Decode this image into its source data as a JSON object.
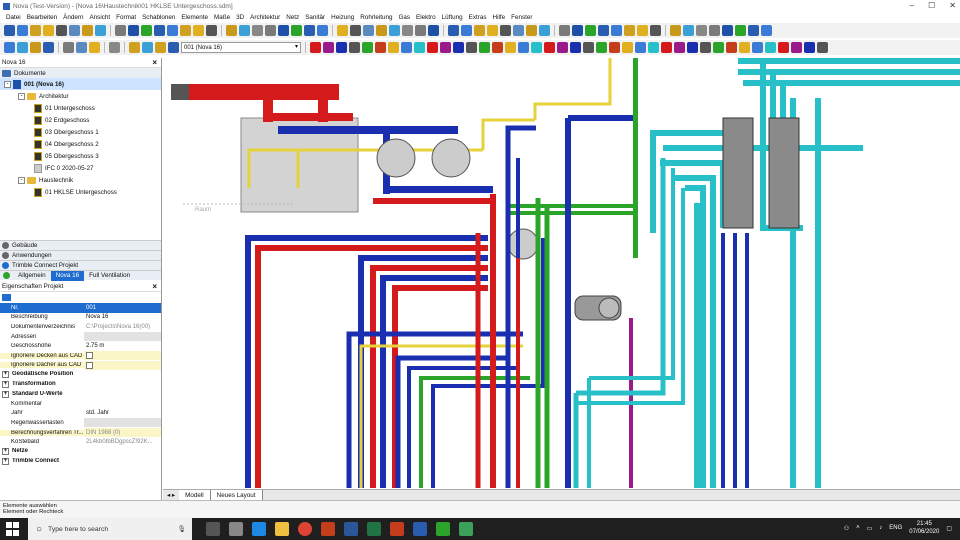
{
  "window": {
    "title": "Nova (Test-Version) - [Nova 16\\Haustechnik\\01 HKLSE Untergeschoss.sdm]"
  },
  "menu": [
    "Datei",
    "Bearbeiten",
    "Ändern",
    "Ansicht",
    "Format",
    "Schablonen",
    "Elemente",
    "Maße",
    "3D",
    "Architektur",
    "Netz",
    "Sanitär",
    "Heizung",
    "Rohrleitung",
    "Gas",
    "Elektro",
    "Lüftung",
    "Extras",
    "Hilfe",
    "Fenster"
  ],
  "toolbar": {
    "project_combo": "001 (Nova 16)"
  },
  "documents_panel": {
    "header": "Nova 16",
    "section": "Dokumente",
    "root": "001 (Nova 16)",
    "architektur": "Architektur",
    "floors": [
      "01 Untergeschoss",
      "02 Erdgeschoss",
      "03 Obergeschoss 1",
      "04 Obergeschoss 2",
      "05 Obergeschoss 3",
      "IFC 0 2020-05-27"
    ],
    "haustechnik": "Haustechnik",
    "ht_items": [
      "01 HKLSE Untergeschoss"
    ],
    "sections": [
      "Gebäude",
      "Anwendungen",
      "Trimble Connect Projekt"
    ],
    "tabs": [
      "Allgemein",
      "Nova 16",
      "Full Ventilation"
    ]
  },
  "properties_panel": {
    "header": "Eigenschaften Projekt",
    "rows": [
      {
        "name": "Nr.",
        "value": "001",
        "selected": true
      },
      {
        "name": "Beschreibung",
        "value": "Nova 16"
      },
      {
        "name": "Dokumentenverzeichnis",
        "value": "C:\\Projects\\Nova 16(00)"
      },
      {
        "name": "Adressen",
        "value": ""
      },
      {
        "name": "Geschosshöhe",
        "value": "2.75 m"
      },
      {
        "name": "Ignoriere Decken aus CAD",
        "value": "",
        "check": true,
        "hl": true
      },
      {
        "name": "Ignoriere Dächer aus CAD",
        "value": "",
        "check": true,
        "hl": true
      },
      {
        "name": "Geodätische Position",
        "value": "",
        "group": true
      },
      {
        "name": "Transformation",
        "value": "",
        "group": true
      },
      {
        "name": "Standard U-Werte",
        "value": "",
        "group": true
      },
      {
        "name": "Kommentar",
        "value": ""
      },
      {
        "name": "Jahr",
        "value": "std. Jahr"
      },
      {
        "name": "Regenwasserlasten",
        "value": ""
      },
      {
        "name": "Berechnungsverfahren Tr...",
        "value": "DIN 1988 (0)",
        "hl": true
      },
      {
        "name": "KoStebaId",
        "value": "2L4kb0IbBDgpscZ!92K..."
      },
      {
        "name": "Netze",
        "value": "",
        "group": true
      },
      {
        "name": "Trimble Connect",
        "value": "",
        "group": true
      }
    ]
  },
  "canvas": {
    "hint_label": "Raum"
  },
  "layout_tabs": [
    "Modell",
    "Neues Layout"
  ],
  "status": {
    "line1": "Elemente auswählen",
    "line2": "Element oder Rechteck"
  },
  "taskbar": {
    "search_placeholder": "Type here to search",
    "lang": "ENG",
    "time": "21:45",
    "date": "07/06/2020"
  },
  "colors": {
    "accent": "#1e6cd0",
    "red_pipe": "#d41a1a",
    "blue_pipe": "#1a2fb0",
    "teal_pipe": "#28c0c8",
    "green_pipe": "#2aa52a",
    "yellow_pipe": "#e6d23a",
    "purple_pipe": "#9a1a8a"
  }
}
